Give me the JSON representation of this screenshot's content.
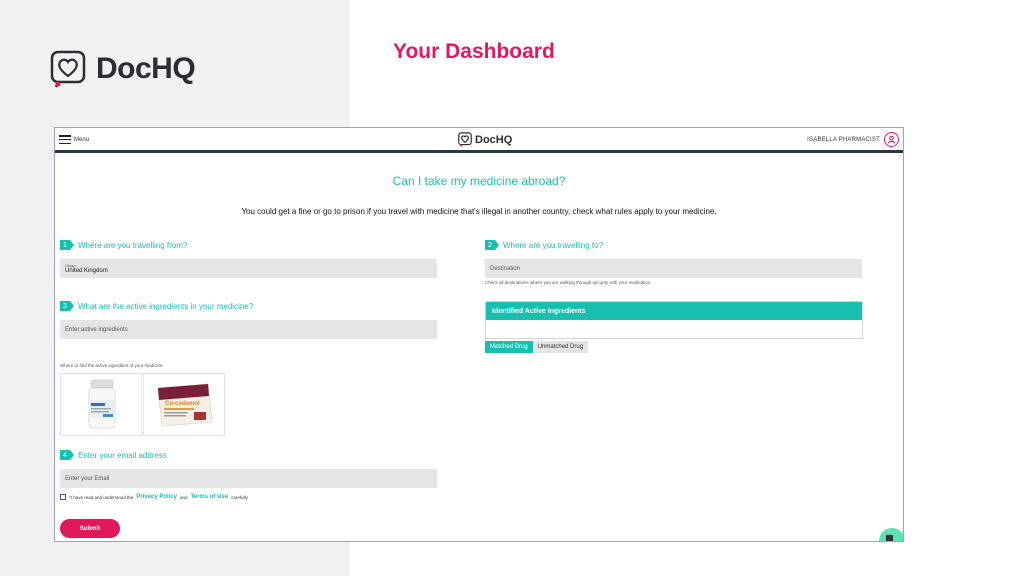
{
  "slide": {
    "brand": "DocHQ",
    "heading": "Your Dashboard"
  },
  "topbar": {
    "menu_label": "Menu",
    "logo_text": "DocHQ",
    "user_name": "ISABELLA PHARMACIST"
  },
  "page": {
    "title": "Can I take my medicine abroad?",
    "subtitle": "You could get a fine or go to prison if you travel with medicine that's illegal in another country, check what rules apply to your medicine."
  },
  "steps": [
    {
      "num": "1",
      "label": "Where are you travelling from?"
    },
    {
      "num": "2",
      "label": "Where are you travelling to?"
    },
    {
      "num": "3",
      "label": "What are the active ingredients in your medicine?"
    },
    {
      "num": "4",
      "label": "Enter your email address"
    }
  ],
  "origin": {
    "small_label": "Origin",
    "value": "United Kingdom"
  },
  "destination": {
    "placeholder": "Destination",
    "hint": "Check all destinations where you are walking through security with your medication."
  },
  "ingredients": {
    "placeholder": "Enter active ingredients",
    "hint": "Where to find the active ingredient of your medicine",
    "panel_title": "Identified Active Ingredients",
    "chip_matched": "Matched Drug",
    "chip_unmatched": "Unmatched Drug",
    "product_label": "Co-codamol"
  },
  "email": {
    "placeholder": "Enter your Email"
  },
  "consent": {
    "prefix": "*I have read and understood the",
    "privacy": "Privacy Policy",
    "and": "and",
    "terms": "Terms of Use",
    "suffix": "carefully"
  },
  "submit_label": "Submit",
  "colors": {
    "teal": "#17bfae",
    "pink": "#e0195a",
    "dark": "#2e3442"
  }
}
